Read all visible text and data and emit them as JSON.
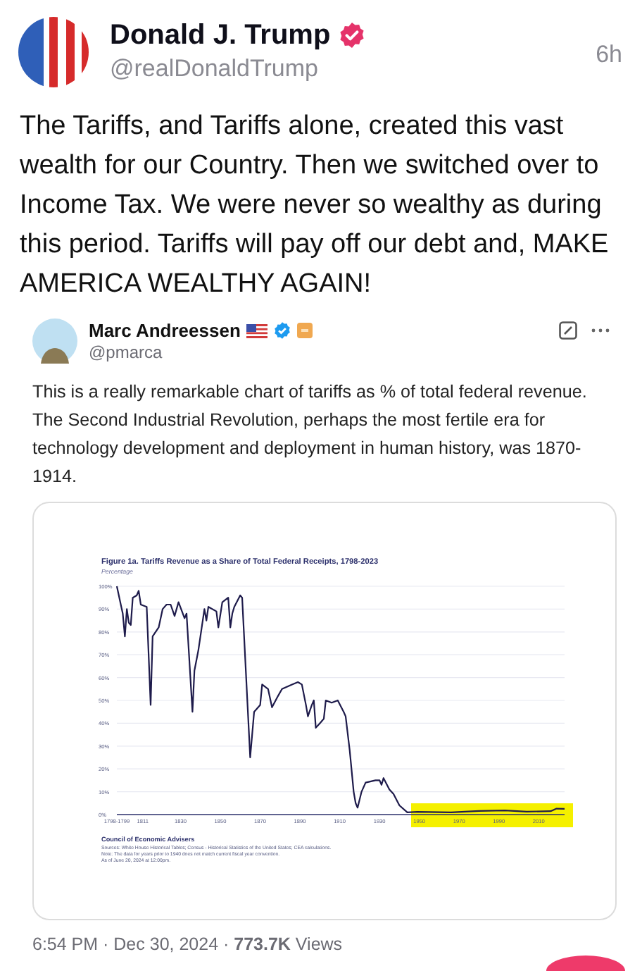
{
  "post": {
    "author": {
      "name": "Donald J. Trump",
      "verified": true,
      "handle": "@realDonaldTrump"
    },
    "time": "6h",
    "text": "The Tariffs, and Tariffs alone, created this vast wealth for our Country. Then we switched over to Income Tax. We were never so wealthy as during this period. Tariffs will pay off our debt and, MAKE AMERICA WEALTHY AGAIN!"
  },
  "quoted_post": {
    "author": {
      "name": "Marc Andreessen",
      "verified": true,
      "handle": "@pmarca"
    },
    "text": "This is a really remarkable chart of tariffs as % of total federal revenue. The Second Industrial Revolution, perhaps the most fertile era for technology development and deployment in human history, was 1870-1914.",
    "chart_image": {
      "chart_data": {
        "type": "line",
        "title": "Figure 1a. Tariffs Revenue as a Share of Total Federal Receipts, 1798-2023",
        "ylabel": "Percentage",
        "xlim": [
          1798,
          2023
        ],
        "ylim": [
          0,
          100
        ],
        "xticks": [
          {
            "value": 1798,
            "label": "1798-1799"
          },
          1811,
          1830,
          1850,
          1870,
          1890,
          1910,
          1930,
          1950,
          1970,
          1990,
          2010
        ],
        "yticks": [
          {
            "value": 0,
            "label": "0%"
          },
          {
            "value": 10,
            "label": "10%"
          },
          {
            "value": 20,
            "label": "20%"
          },
          {
            "value": 30,
            "label": "30%"
          },
          {
            "value": 40,
            "label": "40%"
          },
          {
            "value": 50,
            "label": "50%"
          },
          {
            "value": 60,
            "label": "60%"
          },
          {
            "value": 70,
            "label": "70%"
          },
          {
            "value": 80,
            "label": "80%"
          },
          {
            "value": 90,
            "label": "90%"
          },
          {
            "value": 100,
            "label": "100%"
          }
        ],
        "x": [
          1798,
          1800,
          1801,
          1802,
          1803,
          1804,
          1805,
          1806,
          1808,
          1809,
          1810,
          1813,
          1815,
          1816,
          1819,
          1821,
          1823,
          1825,
          1827,
          1829,
          1832,
          1833,
          1836,
          1837,
          1839,
          1842,
          1843,
          1844,
          1848,
          1849,
          1851,
          1854,
          1855,
          1856,
          1857,
          1860,
          1861,
          1865,
          1867,
          1870,
          1871,
          1874,
          1876,
          1879,
          1881,
          1886,
          1889,
          1891,
          1893,
          1894,
          1896,
          1897,
          1898,
          1900,
          1902,
          1903,
          1906,
          1909,
          1912,
          1913,
          1915,
          1917,
          1918,
          1919,
          1921,
          1923,
          1928,
          1930,
          1931,
          1932,
          1935,
          1937,
          1940,
          1944,
          1949,
          1966,
          1980,
          1993,
          2004,
          2016,
          2019,
          2023
        ],
        "grid": true,
        "series": [
          {
            "color": "#1e1b4b",
            "values": [
              100,
              92,
              88,
              78,
              90,
              84,
              83,
              95,
              96,
              98,
              92,
              91,
              48,
              78,
              82,
              90,
              92,
              92,
              87,
              93,
              86,
              88,
              45,
              63,
              72,
              90,
              85,
              91,
              89,
              82,
              93,
              95,
              82,
              88,
              91,
              96,
              95,
              25,
              45,
              48,
              57,
              55,
              47,
              52,
              55,
              57,
              58,
              57,
              48,
              43,
              48,
              50,
              38,
              40,
              42,
              50,
              49,
              50,
              45,
              43,
              28,
              10,
              5,
              3,
              10,
              14,
              15,
              15,
              13,
              16,
              11,
              9,
              4,
              1,
              1.2,
              1,
              1.6,
              1.8,
              1.3,
              1.5,
              2.6,
              2.5
            ]
          }
        ]
      },
      "highlight": {
        "color": "#f5f000"
      },
      "source": "Council of Economic Advisers",
      "notes": [
        "Sources: White House Historical Tables; Census - Historical Statistics of the United States; CEA calculations.",
        "Note: The data for years prior to 1940 does not match current fiscal year convention.",
        "As of June 20, 2024 at 12:00pm."
      ]
    },
    "footer": "6:54 PM · Dec 30, 2024 · **773.7K** Views"
  }
}
